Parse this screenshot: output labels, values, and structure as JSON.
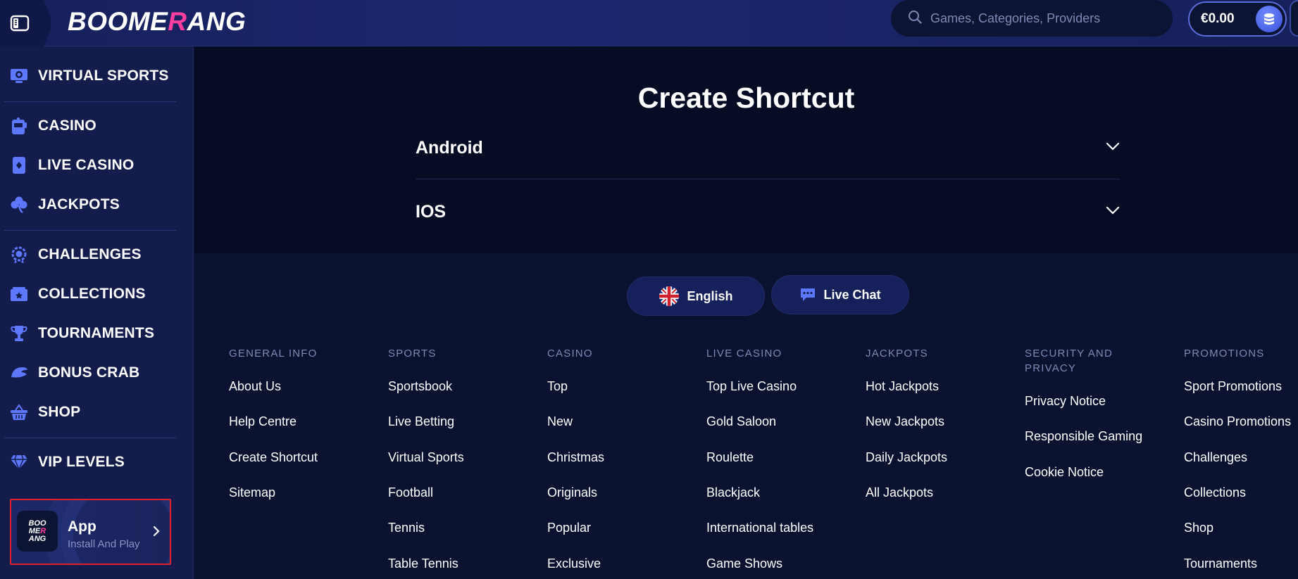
{
  "header": {
    "logo_main": "BOOME",
    "logo_accent": "R",
    "logo_tail": "ANG",
    "search_placeholder": "Games, Categories, Providers",
    "balance": "€0.00"
  },
  "sidebar": {
    "items": [
      {
        "label": "VIRTUAL SPORTS",
        "icon": "monitor-ball-icon"
      },
      {
        "label": "CASINO",
        "icon": "slot-machine-icon"
      },
      {
        "label": "LIVE CASINO",
        "icon": "playing-card-icon"
      },
      {
        "label": "JACKPOTS",
        "icon": "clover-icon"
      },
      {
        "label": "CHALLENGES",
        "icon": "medal-icon"
      },
      {
        "label": "COLLECTIONS",
        "icon": "cards-stack-icon"
      },
      {
        "label": "TOURNAMENTS",
        "icon": "trophy-icon"
      },
      {
        "label": "BONUS CRAB",
        "icon": "crab-claw-icon"
      },
      {
        "label": "SHOP",
        "icon": "basket-icon"
      },
      {
        "label": "VIP LEVELS",
        "icon": "diamond-icon"
      }
    ],
    "app_card": {
      "title": "App",
      "subtitle": "Install And Play",
      "icon_line1": "BOO",
      "icon_line2a": "ME",
      "icon_line2b": "R",
      "icon_line3": "ANG"
    }
  },
  "main": {
    "title": "Create Shortcut",
    "accordions": [
      {
        "label": "Android"
      },
      {
        "label": "IOS"
      }
    ],
    "language_button": "English",
    "live_chat_button": "Live Chat"
  },
  "footer": {
    "columns": [
      {
        "heading": "GENERAL INFO",
        "links": [
          "About Us",
          "Help Centre",
          "Create Shortcut",
          "Sitemap"
        ]
      },
      {
        "heading": "SPORTS",
        "links": [
          "Sportsbook",
          "Live Betting",
          "Virtual Sports",
          "Football",
          "Tennis",
          "Table Tennis"
        ]
      },
      {
        "heading": "CASINO",
        "links": [
          "Top",
          "New",
          "Christmas",
          "Originals",
          "Popular",
          "Exclusive"
        ]
      },
      {
        "heading": "LIVE CASINO",
        "links": [
          "Top Live Casino",
          "Gold Saloon",
          "Roulette",
          "Blackjack",
          "International tables",
          "Game Shows"
        ]
      },
      {
        "heading": "JACKPOTS",
        "links": [
          "Hot Jackpots",
          "New Jackpots",
          "Daily Jackpots",
          "All Jackpots"
        ]
      },
      {
        "heading_line1": "SECURITY AND",
        "heading_line2": "PRIVACY",
        "links": [
          "Privacy Notice",
          "Responsible Gaming",
          "Cookie Notice"
        ]
      },
      {
        "heading": "PROMOTIONS",
        "links": [
          "Sport Promotions",
          "Casino Promotions",
          "Challenges",
          "Collections",
          "Shop",
          "Tournaments"
        ]
      }
    ]
  },
  "colors": {
    "background": "#0a1230",
    "sidebar": "#131c4a",
    "accent_pink": "#ff3f9f",
    "highlight_border": "#e0202a",
    "muted_text": "#8089b4"
  }
}
